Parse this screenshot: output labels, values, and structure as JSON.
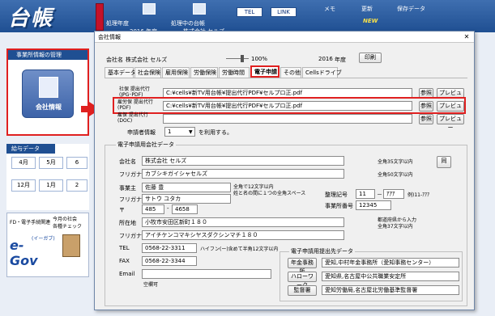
{
  "app": {
    "logo": "台帳",
    "header_labels": {
      "processing_year": "処理年度",
      "processing_ledger": "処理中の台帳",
      "memo": "メモ",
      "update": "更新",
      "save_data": "保存データ",
      "year_value": "2016 年度",
      "company_value": "株式会社 セルズ",
      "new_badge": "NEW"
    },
    "tel_button": "TEL",
    "link_button": "LINK"
  },
  "left_panel": {
    "title": "事業所情報の管理",
    "company_info_label": "会社情報"
  },
  "salary_panel": {
    "title": "給与データ",
    "months": [
      "4月",
      "5月",
      "6",
      "12月",
      "1月",
      "2"
    ]
  },
  "bottom_panel": {
    "fd_label": "FD・電子手続関連",
    "monthly_label": "今月の社会\n各種チェック",
    "egov": "e-Gov",
    "egov_sub": "(イーガブ)"
  },
  "dialog": {
    "title": "会社情報",
    "close": "✕",
    "company_name_label": "会社名",
    "company_name": "株式会社 セルズ",
    "zoom": "100%",
    "year": "2016",
    "year_unit": "年度",
    "print_button": "印刷",
    "tabs": [
      "基本データ",
      "社会保険",
      "雇用保険",
      "労働保険",
      "労働時間",
      "電子申請",
      "その他",
      "Cellsドライブ"
    ],
    "active_tab": "電子申請",
    "agency_rows": [
      {
        "label": "社保 提出代行\n(JPG･PDF)",
        "path": "C:¥cells¥新TV用台帳¥提出代行PDF¥セルプロ正.pdf",
        "ref": "参照",
        "preview": "プレビュー"
      },
      {
        "label": "雇労保 提出代行\n(PDF)",
        "path": "C:¥cells¥新TV用台帳¥提出代行PDF¥セルプロ正.pdf",
        "ref": "参照",
        "preview": "プレビュー"
      },
      {
        "label": "雇保 提出代行\n(DOC)",
        "path": "",
        "ref": "参照",
        "preview": "プレビュー"
      }
    ],
    "applicant_info_label": "申請者情報",
    "applicant_info_value": "1",
    "applicant_info_suffix": "を利用する。",
    "group_title": "電子申請用会社データ",
    "company_label": "会社名",
    "company_value": "株式会社 セルズ",
    "company_hint": "全角35文字以内",
    "same_button": "同",
    "furigana_label": "フリガナ",
    "furigana_value": "カブシキガイシャセルズ",
    "furigana_hint": "全角50文字以内",
    "owner_label": "事業主",
    "owner_value": "佐藤 豊",
    "owner_hint1": "全角で12文字以内",
    "owner_hint2": "姓と名の間に１つの全角スペース",
    "owner_furigana_label": "フリガナ",
    "owner_furigana_value": "サトウ ユタカ",
    "zip_label": "〒",
    "zip1": "485",
    "zip2": "4658",
    "reg_label": "整理記号",
    "reg1": "11",
    "reg_dash": "－",
    "reg2": "ｱｱｱ",
    "reg_example": "例)11-ｱｱｱ",
    "office_no_label": "事業所番号",
    "office_no_value": "12345",
    "address_label": "所在地",
    "address_value": "小牧市安田区新町１８０",
    "address_hint1": "都道府県から入力",
    "address_hint2": "全角37文字以内",
    "address_furigana_label": "フリガナ",
    "address_furigana_value": "アイチケンコマキシヤスダクシンマチ１８０",
    "tel_label": "TEL",
    "tel_value": "0568-22-3311",
    "tel_hint": "ハイフン(ー)含めて半角12文字以内",
    "fax_label": "FAX",
    "fax_value": "0568-22-3344",
    "email_label": "Email",
    "email_value": "",
    "email_hint": "空欄可",
    "dest_group_title": "電子申請用提出先データ",
    "dest_rows": [
      {
        "button": "年金事務所",
        "value": "愛知,中村年金事務所（愛知事務センター）"
      },
      {
        "button": "ハローワーク",
        "value": "愛知県,名古屋中公共職業安定所"
      },
      {
        "button": "監督署",
        "value": "愛知労働局,名古屋北労働基準監督署"
      }
    ]
  }
}
